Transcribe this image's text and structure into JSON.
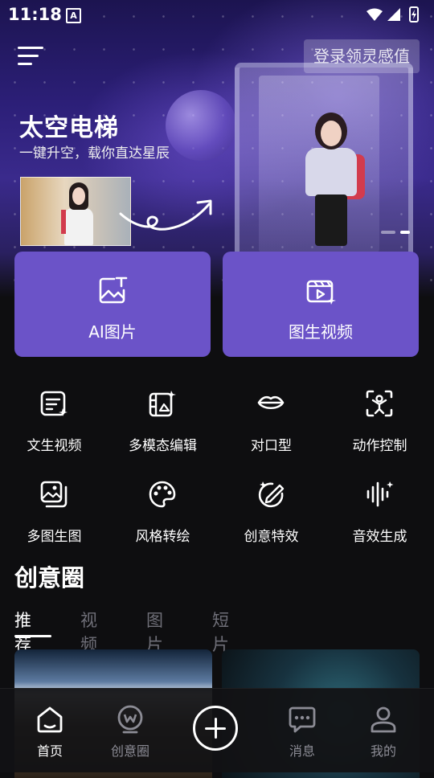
{
  "status_bar": {
    "time": "11:18",
    "notification_icon": "A"
  },
  "header": {
    "login_button": "登录领灵感值"
  },
  "banner": {
    "title": "太空电梯",
    "subtitle": "一键升空，载你直达星辰"
  },
  "primary_actions": [
    {
      "label": "AI图片",
      "icon": "ai-image-icon"
    },
    {
      "label": "图生视频",
      "icon": "image-to-video-icon"
    }
  ],
  "tools": [
    {
      "label": "文生视频",
      "icon": "text-to-video-icon"
    },
    {
      "label": "多模态编辑",
      "icon": "multimodal-edit-icon"
    },
    {
      "label": "对口型",
      "icon": "lip-sync-icon"
    },
    {
      "label": "动作控制",
      "icon": "motion-control-icon"
    },
    {
      "label": "多图生图",
      "icon": "multi-image-icon"
    },
    {
      "label": "风格转绘",
      "icon": "palette-icon"
    },
    {
      "label": "创意特效",
      "icon": "creative-effects-icon"
    },
    {
      "label": "音效生成",
      "icon": "sound-effects-icon"
    }
  ],
  "feed": {
    "title": "创意圈",
    "tabs": [
      "推荐",
      "视频",
      "图片",
      "短片"
    ],
    "active_tab": "推荐"
  },
  "bottom_nav": [
    {
      "label": "首页",
      "icon": "home-icon",
      "active": true
    },
    {
      "label": "创意圈",
      "icon": "creative-circle-icon",
      "active": false
    },
    {
      "label": "",
      "icon": "create-plus-icon",
      "active": false
    },
    {
      "label": "消息",
      "icon": "message-icon",
      "active": false
    },
    {
      "label": "我的",
      "icon": "profile-icon",
      "active": false
    }
  ],
  "colors": {
    "accent_card": "#6b53c8",
    "background": "#0e0e10"
  }
}
